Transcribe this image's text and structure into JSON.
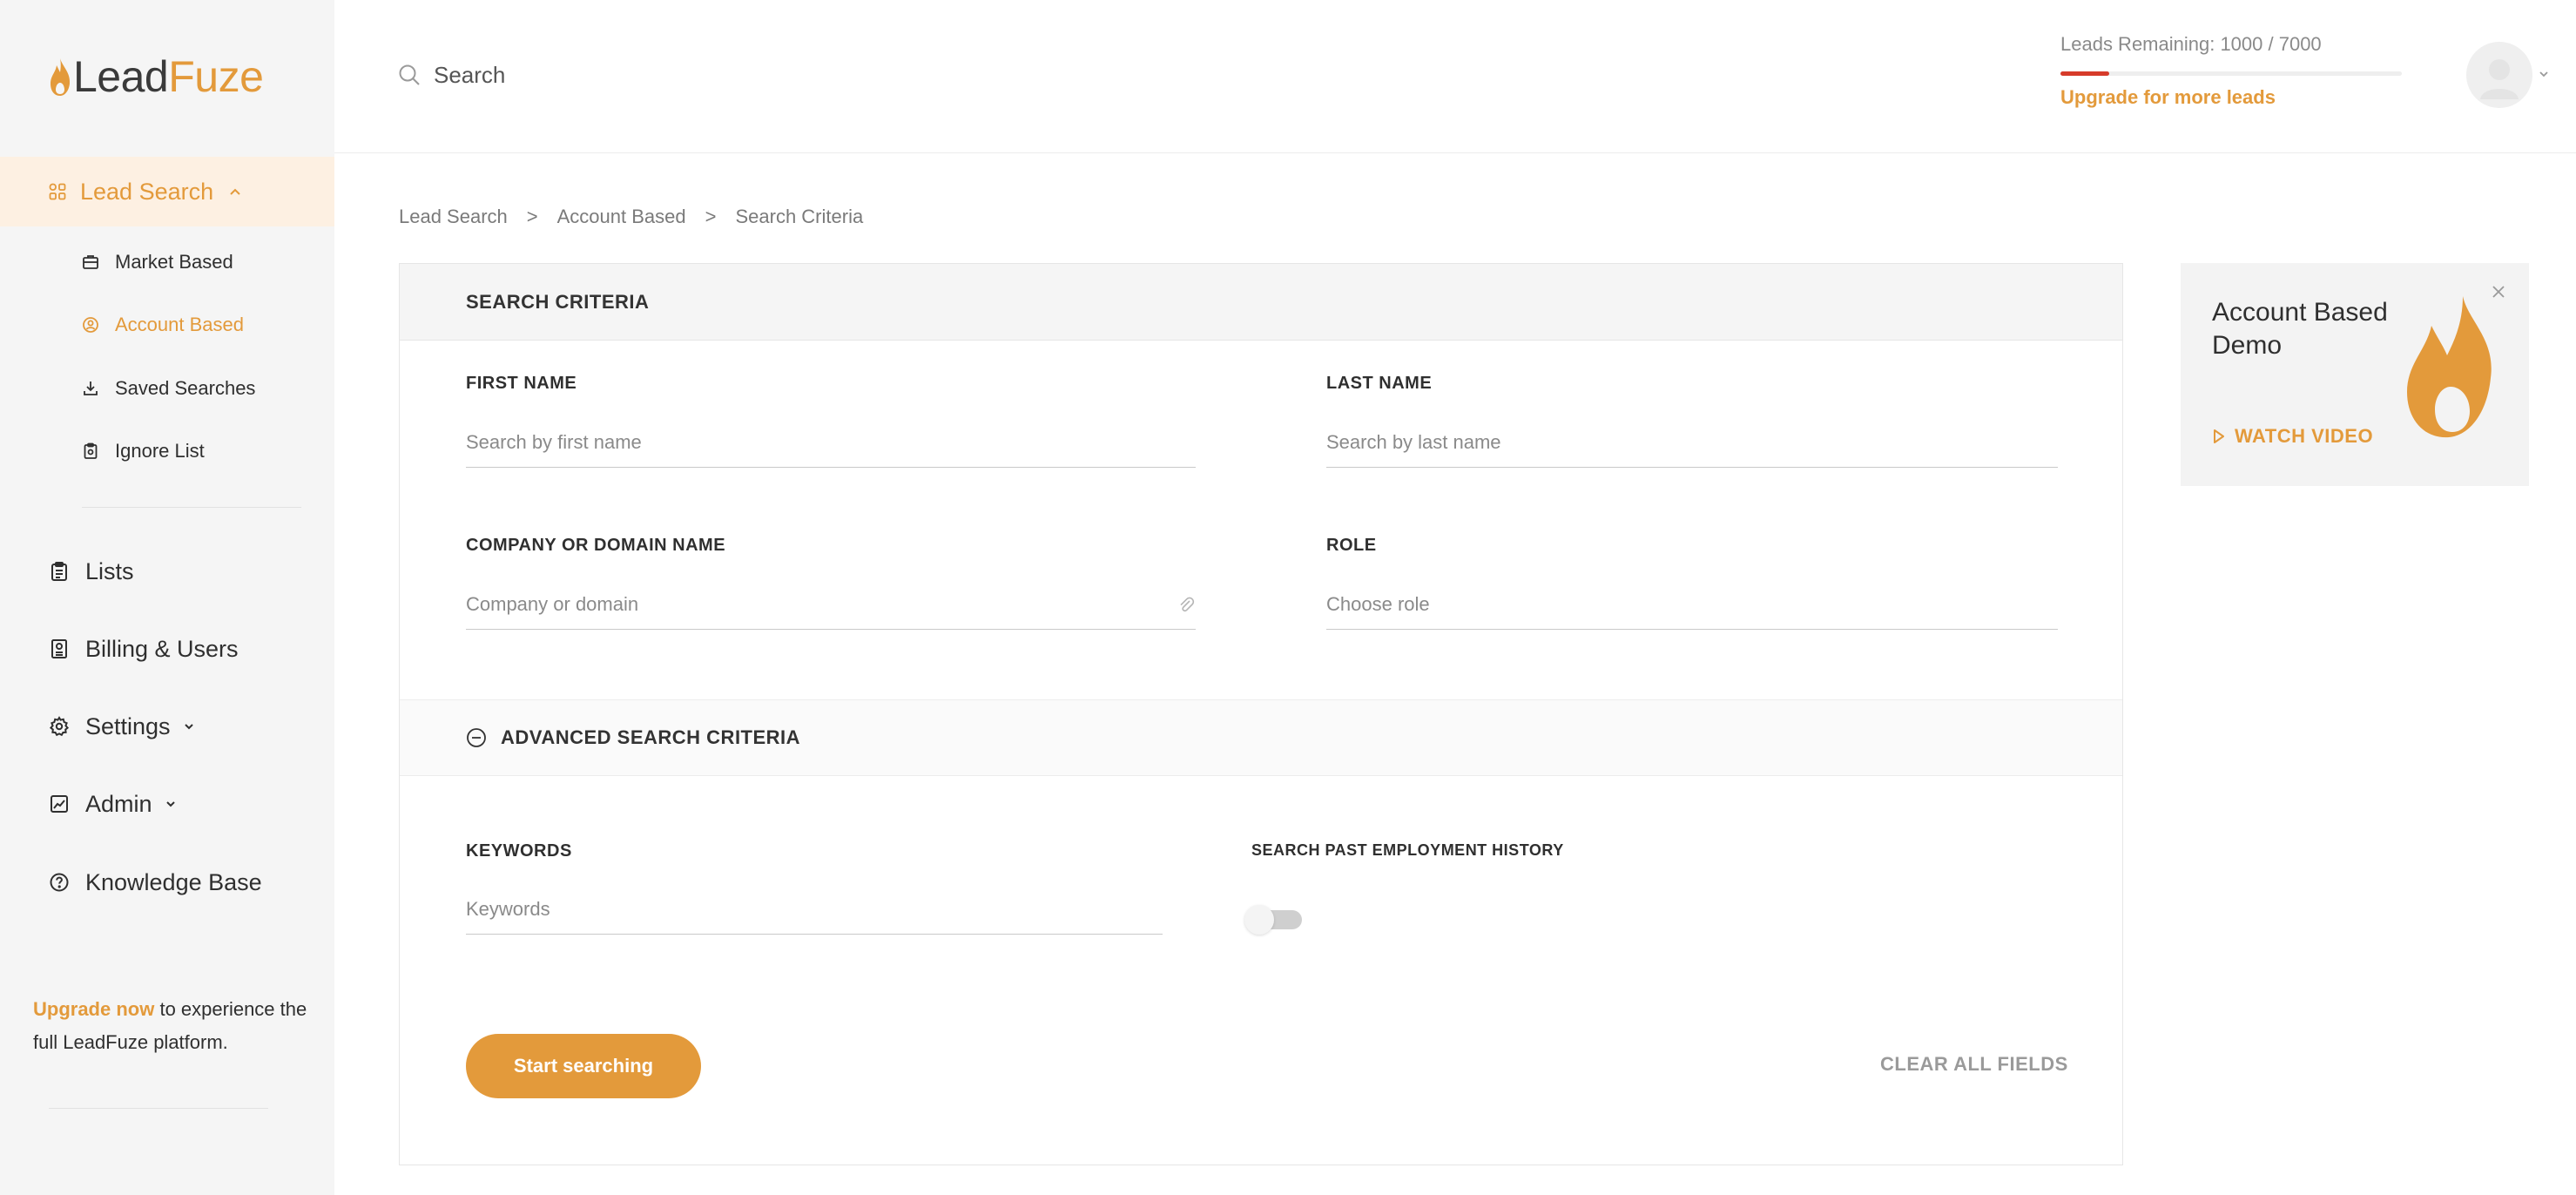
{
  "brand": {
    "logo_text_dark": "Lead",
    "logo_text_accent": "Fuze",
    "accent_color": "#e39a3b"
  },
  "sidebar": {
    "active_section": {
      "label": "Lead Search",
      "icon": "grid-icon"
    },
    "sub_items": [
      {
        "label": "Market Based",
        "icon": "briefcase-icon",
        "active": false
      },
      {
        "label": "Account Based",
        "icon": "account-circle-icon",
        "active": true
      },
      {
        "label": "Saved Searches",
        "icon": "download-icon",
        "active": false
      },
      {
        "label": "Ignore List",
        "icon": "clipboard-block-icon",
        "active": false
      }
    ],
    "items": [
      {
        "label": "Lists",
        "icon": "clipboard-icon"
      },
      {
        "label": "Billing & Users",
        "icon": "receipt-icon"
      },
      {
        "label": "Settings",
        "icon": "gear-icon"
      },
      {
        "label": "Admin",
        "icon": "chart-icon"
      },
      {
        "label": "Knowledge Base",
        "icon": "help-circle-icon"
      }
    ],
    "upgrade": {
      "link": "Upgrade now",
      "text": " to experience the full LeadFuze platform."
    }
  },
  "topbar": {
    "search_placeholder": "Search",
    "leads_remaining": "Leads Remaining: 1000 / 7000",
    "leads_used_fraction": 0.143,
    "upgrade_link": "Upgrade for more leads"
  },
  "breadcrumb": [
    "Lead Search",
    "Account Based",
    "Search Criteria"
  ],
  "breadcrumb_separator": ">",
  "criteria": {
    "title": "SEARCH CRITERIA",
    "first_name": {
      "label": "FIRST NAME",
      "placeholder": "Search by first name"
    },
    "last_name": {
      "label": "LAST NAME",
      "placeholder": "Search by last name"
    },
    "company": {
      "label": "COMPANY OR DOMAIN NAME",
      "placeholder": "Company or domain"
    },
    "role": {
      "label": "ROLE",
      "placeholder": "Choose role"
    },
    "advanced_title": "ADVANCED SEARCH CRITERIA",
    "keywords": {
      "label": "KEYWORDS",
      "placeholder": "Keywords"
    },
    "employment_history": {
      "label": "SEARCH PAST EMPLOYMENT HISTORY",
      "enabled": false
    },
    "start_button": "Start searching",
    "clear_button": "CLEAR ALL FIELDS"
  },
  "demo": {
    "title": "Account Based Demo",
    "watch_label": "WATCH VIDEO"
  }
}
